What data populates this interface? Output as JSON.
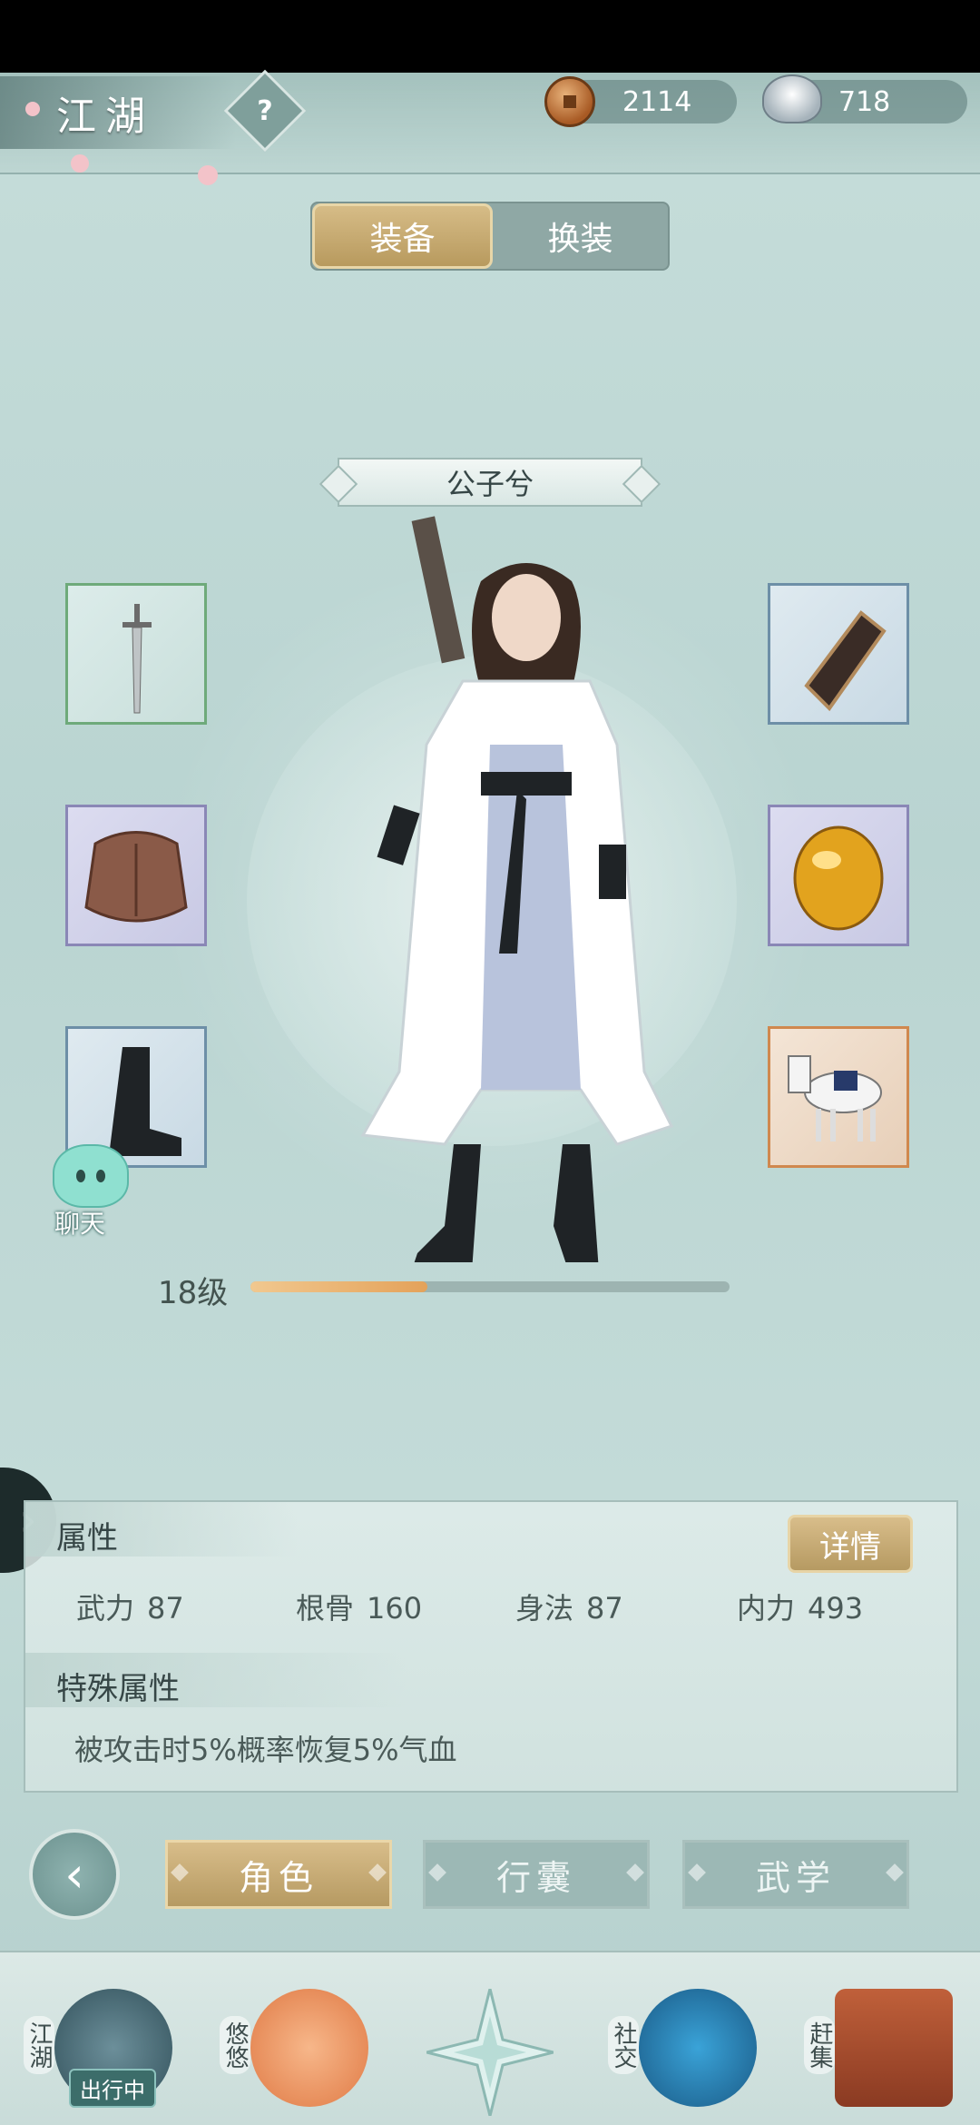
{
  "header": {
    "title": "江湖",
    "help_glyph": "?",
    "copper_coins": "2114",
    "silver_ingots": "718"
  },
  "segment": {
    "tabs": [
      {
        "label": "装备",
        "active": true
      },
      {
        "label": "换装",
        "active": false
      }
    ]
  },
  "character": {
    "name": "公子兮",
    "level_label": "18级",
    "level_progress": 0.37
  },
  "equipment_slots": [
    {
      "id": "weapon",
      "icon": "sword-icon"
    },
    {
      "id": "armor",
      "icon": "leather-armor-icon"
    },
    {
      "id": "boots",
      "icon": "boots-icon"
    },
    {
      "id": "bracer",
      "icon": "bracer-icon"
    },
    {
      "id": "accessory",
      "icon": "amber-gem-icon"
    },
    {
      "id": "mount",
      "icon": "white-horse-icon"
    }
  ],
  "chat": {
    "label": "聊天"
  },
  "attributes": {
    "title": "属性",
    "detail_button": "详情",
    "stats": [
      {
        "label": "武力",
        "value": "87"
      },
      {
        "label": "根骨",
        "value": "160"
      },
      {
        "label": "身法",
        "value": "87"
      },
      {
        "label": "内力",
        "value": "493"
      }
    ],
    "special_title": "特殊属性",
    "special_text": "被攻击时5%概率恢复5%气血"
  },
  "bottom_tabs": [
    {
      "label": "角色",
      "active": true
    },
    {
      "label": "行囊",
      "active": false
    },
    {
      "label": "武学",
      "active": false
    }
  ],
  "dock": {
    "items": [
      {
        "label": "江湖",
        "badge": "出行中"
      },
      {
        "label": "悠悠"
      },
      {
        "label": ""
      },
      {
        "label": "社交"
      },
      {
        "label": "赶集"
      }
    ]
  },
  "colors": {
    "gold_button": "#c7aa72",
    "teal_bg": "#bcd6d3",
    "progress_fill": "#e9ac68"
  }
}
